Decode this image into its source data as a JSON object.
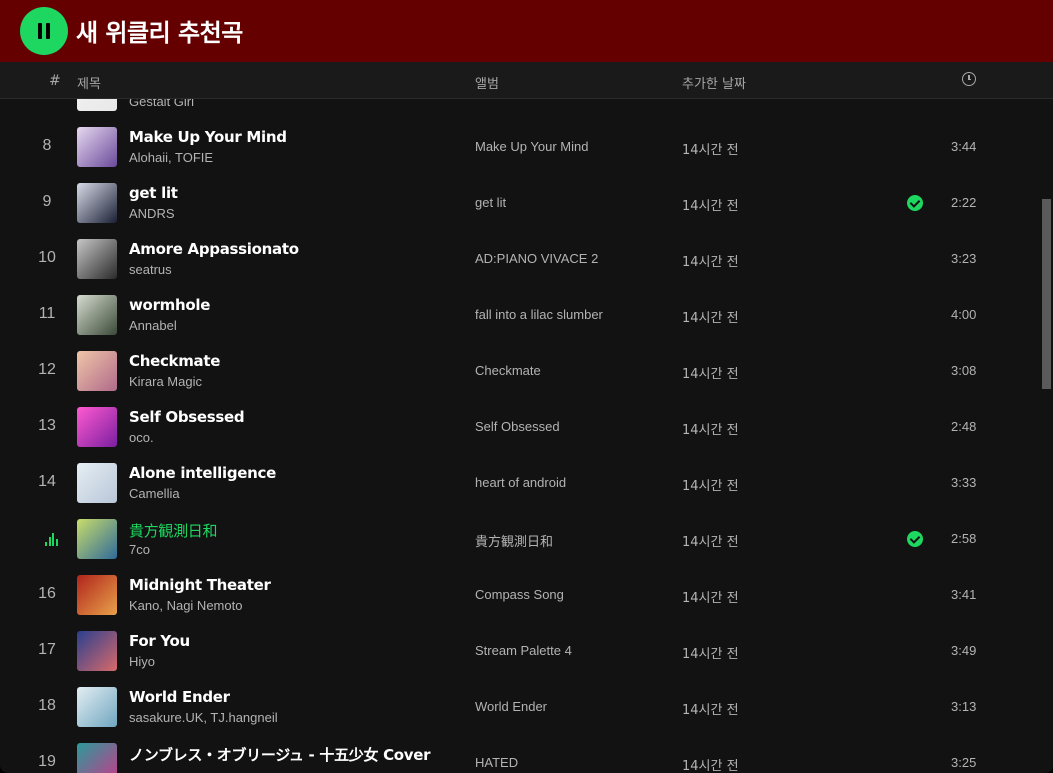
{
  "playlist": {
    "title": "새 위클리 추천곡",
    "accent_color": "#1ed760",
    "banner_color": "#650000"
  },
  "columns": {
    "number": "#",
    "title": "제목",
    "album": "앨범",
    "date_added": "추가한 날짜",
    "duration_icon": "clock-icon"
  },
  "tracks": [
    {
      "num": "",
      "title": "",
      "artist": "Gestalt Girl",
      "album": "",
      "added": "",
      "duration": "",
      "saved": false,
      "playing": false,
      "cover": [
        "#f2f2f2",
        "#e8e8e8"
      ]
    },
    {
      "num": "8",
      "title": "Make Up Your Mind",
      "artist": "Alohaii, TOFIE",
      "album": "Make Up Your Mind",
      "added": "14시간 전",
      "duration": "3:44",
      "saved": false,
      "playing": false,
      "cover": [
        "#e7d9f0",
        "#6a4a9a"
      ]
    },
    {
      "num": "9",
      "title": "get lit",
      "artist": "ANDRS",
      "album": "get lit",
      "added": "14시간 전",
      "duration": "2:22",
      "saved": true,
      "playing": false,
      "cover": [
        "#d8dce8",
        "#1b2036"
      ]
    },
    {
      "num": "10",
      "title": "Amore Appassionato",
      "artist": "seatrus",
      "album": "AD:PIANO VIVACE 2",
      "added": "14시간 전",
      "duration": "3:23",
      "saved": false,
      "playing": false,
      "cover": [
        "#c7c7c7",
        "#2a2a2a"
      ]
    },
    {
      "num": "11",
      "title": "wormhole",
      "artist": "Annabel",
      "album": "fall into a lilac slumber",
      "added": "14시간 전",
      "duration": "4:00",
      "saved": false,
      "playing": false,
      "cover": [
        "#d6dcd0",
        "#3b4a38"
      ]
    },
    {
      "num": "12",
      "title": "Checkmate",
      "artist": "Kirara Magic",
      "album": "Checkmate",
      "added": "14시간 전",
      "duration": "3:08",
      "saved": false,
      "playing": false,
      "cover": [
        "#f0c6a8",
        "#b06a8a"
      ]
    },
    {
      "num": "13",
      "title": "Self Obsessed",
      "artist": "oco.",
      "album": "Self Obsessed",
      "added": "14시간 전",
      "duration": "2:48",
      "saved": false,
      "playing": false,
      "cover": [
        "#ff5ad0",
        "#7a1fa0"
      ]
    },
    {
      "num": "14",
      "title": "Alone intelligence",
      "artist": "Camellia",
      "album": "heart of android",
      "added": "14시간 전",
      "duration": "3:33",
      "saved": false,
      "playing": false,
      "cover": [
        "#e6eef4",
        "#b8c6d8"
      ]
    },
    {
      "num": "",
      "title": "貴方観測日和",
      "artist": "7co",
      "album": "貴方観測日和",
      "added": "14시간 전",
      "duration": "2:58",
      "saved": true,
      "playing": true,
      "cover": [
        "#c9dd6a",
        "#2f6a9a"
      ]
    },
    {
      "num": "16",
      "title": "Midnight Theater",
      "artist": "Kano, Nagi Nemoto",
      "album": "Compass Song",
      "added": "14시간 전",
      "duration": "3:41",
      "saved": false,
      "playing": false,
      "cover": [
        "#b0241c",
        "#e8a24a"
      ]
    },
    {
      "num": "17",
      "title": "For You",
      "artist": "Hiyo",
      "album": "Stream Palette 4",
      "added": "14시간 전",
      "duration": "3:49",
      "saved": false,
      "playing": false,
      "cover": [
        "#2a3f8f",
        "#d86a6a"
      ]
    },
    {
      "num": "18",
      "title": "World Ender",
      "artist": "sasakure.UK, TJ.hangneil",
      "album": "World Ender",
      "added": "14시간 전",
      "duration": "3:13",
      "saved": false,
      "playing": false,
      "cover": [
        "#e4eef2",
        "#6fa6c0"
      ]
    },
    {
      "num": "19",
      "title": "ノンブレス・オブリージュ - 十五少女 Cover",
      "artist": "",
      "album": "HATED",
      "added": "14시간 전",
      "duration": "3:25",
      "saved": false,
      "playing": false,
      "cover": [
        "#2a9a9a",
        "#c83a8a"
      ]
    }
  ]
}
